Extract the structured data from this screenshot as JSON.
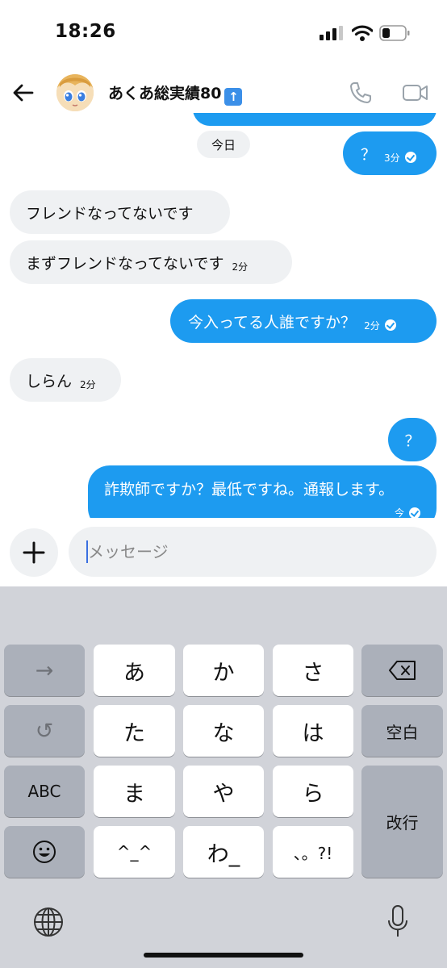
{
  "status_bar": {
    "time": "18:26"
  },
  "header": {
    "contact_name": "あくあ総実績80",
    "badge_icon": "up-arrow-icon"
  },
  "chat": {
    "date_divider": "今日",
    "messages": [
      {
        "side": "out",
        "text": "？",
        "time": "3分",
        "read": true
      },
      {
        "side": "in",
        "text": "フレンドなってないです",
        "time": ""
      },
      {
        "side": "in",
        "text": "まずフレンドなってないです",
        "time": "2分"
      },
      {
        "side": "out",
        "text": "今入ってる人誰ですか？",
        "time": "2分",
        "read": true
      },
      {
        "side": "in",
        "text": "しらん",
        "time": "2分"
      },
      {
        "side": "out",
        "text": "？",
        "time": ""
      },
      {
        "side": "out",
        "text": "詐欺師ですか？最低ですね。通報します。",
        "time": "今",
        "read": true
      }
    ]
  },
  "composer": {
    "placeholder": "メッセージ"
  },
  "keyboard": {
    "rows": [
      [
        "→",
        "あ",
        "か",
        "さ",
        "⌫"
      ],
      [
        "↺",
        "た",
        "な",
        "は",
        "空白"
      ],
      [
        "ABC",
        "ま",
        "や",
        "ら",
        "改行"
      ],
      [
        "☺",
        "^_^",
        "わ_",
        "、。?!"
      ]
    ],
    "keys": {
      "arrow": "→",
      "undo": "↺",
      "abc": "ABC",
      "emoji": "☺",
      "a": "あ",
      "ka": "か",
      "sa": "さ",
      "ta": "た",
      "na": "な",
      "ha": "は",
      "ma": "ま",
      "ya": "や",
      "ra": "ら",
      "kaomoji": "^_^",
      "wa": "わ_",
      "punct": "、。?!",
      "space": "空白",
      "enter": "改行"
    }
  },
  "colors": {
    "accent": "#1d9bf0",
    "incoming_bubble": "#eff1f3",
    "keyboard_bg": "#d1d3d9"
  }
}
